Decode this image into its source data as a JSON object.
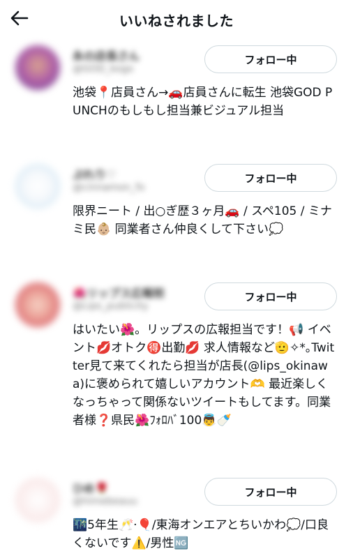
{
  "header": {
    "title": "いいねされました",
    "back_icon": "arrow-left-icon"
  },
  "users": [
    {
      "name": "永の店長さん",
      "handle": "@GOD_kogo",
      "follow_label": "フォロー中",
      "bio": "池袋📍店員さん→🚗店員さんに転生 池袋GOD PUNCHのもしもし担当兼ビジュアル担当"
    },
    {
      "name": "ぷれり♡",
      "handle": "@cinnamon_fo",
      "follow_label": "フォロー中",
      "bio": "限界ニート / 出○ぎ歴３ヶ月🚗 / スペ105 / ミナミ民👶🏼 同業者さん仲良くして下さい💭"
    },
    {
      "name": "🌺リップス広報担",
      "handle": "@Lips_publicity",
      "follow_label": "フォロー中",
      "bio": "はいたい🌺。リップスの広報担当です！📢 イベント💋オトク🉐出勤💋 求人情報など🫡✧*｡Twitter見て来てくれたら担当が店長(@lips_okinawa)に褒められて嬉しいアカウント🫶 最近楽しくなっちゃって関係ないツイートもしてます。同業者様❓県民🌺ﾌｫﾛﾊﾞ100👼🍼"
    },
    {
      "name": "ひめ🌹",
      "handle": "@himebeauu",
      "follow_label": "フォロー中",
      "bio": "🌃5年生🥂·🎈/東海オンエアとちいかわ💭/口良くないです⚠️/男性🆖"
    }
  ],
  "colors": {
    "button_border": "#cfd9de",
    "text": "#0f1419",
    "background": "#ffffff"
  }
}
